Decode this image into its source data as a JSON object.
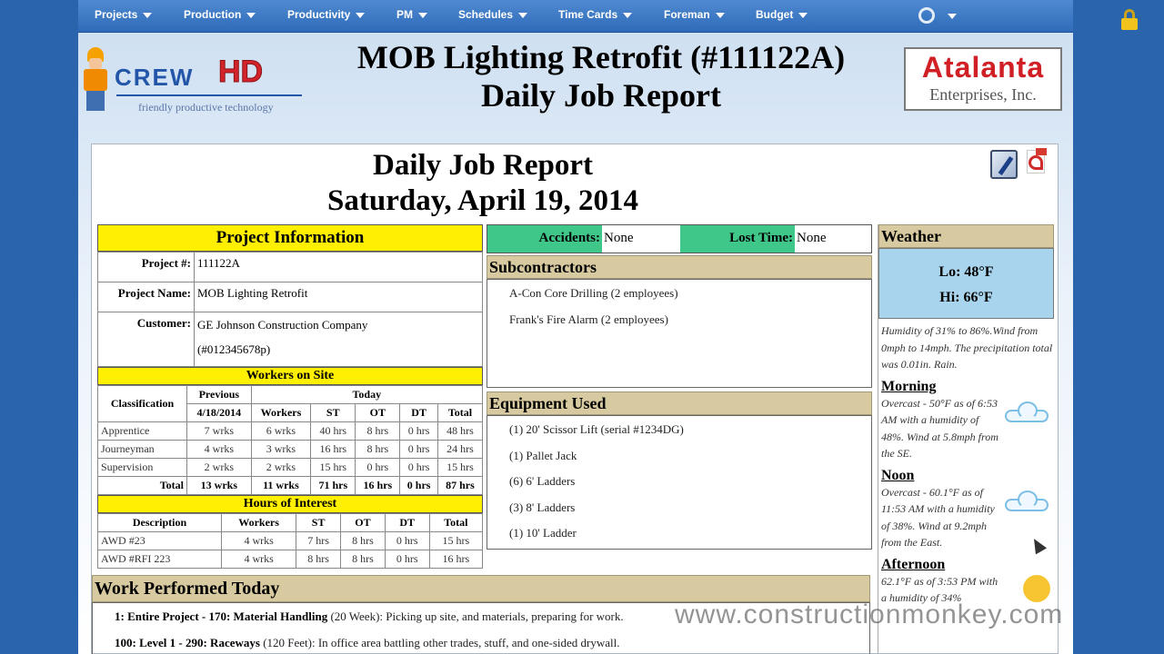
{
  "nav": {
    "items": [
      "Projects",
      "Production",
      "Productivity",
      "PM",
      "Schedules",
      "Time Cards",
      "Foreman",
      "Budget"
    ]
  },
  "branding": {
    "crew": "CREW",
    "hd": "HD",
    "tagline": "friendly productive technology",
    "company_line1": "Atalanta",
    "company_line2": "Enterprises, Inc."
  },
  "header": {
    "title_line1": "MOB Lighting Retrofit (#111122A)",
    "title_line2": "Daily Job Report"
  },
  "report": {
    "title": "Daily Job Report",
    "date": "Saturday, April 19, 2014"
  },
  "project_info": {
    "heading": "Project Information",
    "project_no_label": "Project #:",
    "project_no": "111122A",
    "project_name_label": "Project Name:",
    "project_name": "MOB Lighting Retrofit",
    "customer_label": "Customer:",
    "customer": "GE Johnson Construction Company",
    "customer_id": "(#012345678p)"
  },
  "workers_on_site": {
    "heading": "Workers on Site",
    "h_classification": "Classification",
    "h_previous": "Previous",
    "h_today": "Today",
    "h_prev_date": "4/18/2014",
    "h_workers": "Workers",
    "h_st": "ST",
    "h_ot": "OT",
    "h_dt": "DT",
    "h_total": "Total",
    "rows": [
      {
        "cls": "Apprentice",
        "prev": "7 wrks",
        "workers": "6 wrks",
        "st": "40 hrs",
        "ot": "8 hrs",
        "dt": "0 hrs",
        "total": "48 hrs"
      },
      {
        "cls": "Journeyman",
        "prev": "4 wrks",
        "workers": "3 wrks",
        "st": "16 hrs",
        "ot": "8 hrs",
        "dt": "0 hrs",
        "total": "24 hrs"
      },
      {
        "cls": "Supervision",
        "prev": "2 wrks",
        "workers": "2 wrks",
        "st": "15 hrs",
        "ot": "0 hrs",
        "dt": "0 hrs",
        "total": "15 hrs"
      }
    ],
    "total": {
      "label": "Total",
      "prev": "13 wrks",
      "workers": "11 wrks",
      "st": "71 hrs",
      "ot": "16 hrs",
      "dt": "0 hrs",
      "total": "87 hrs"
    }
  },
  "hours_of_interest": {
    "heading": "Hours of Interest",
    "h_description": "Description",
    "h_workers": "Workers",
    "h_st": "ST",
    "h_ot": "OT",
    "h_dt": "DT",
    "h_total": "Total",
    "rows": [
      {
        "desc": "AWD #23",
        "workers": "4 wrks",
        "st": "7 hrs",
        "ot": "8 hrs",
        "dt": "0 hrs",
        "total": "15 hrs"
      },
      {
        "desc": "AWD #RFI 223",
        "workers": "4 wrks",
        "st": "8 hrs",
        "ot": "8 hrs",
        "dt": "0 hrs",
        "total": "16 hrs"
      }
    ]
  },
  "incidents": {
    "accidents_label": "Accidents:",
    "accidents": "None",
    "lost_time_label": "Lost Time:",
    "lost_time": "None"
  },
  "subcontractors": {
    "heading": "Subcontractors",
    "items": [
      "A-Con Core Drilling (2 employees)",
      "Frank's Fire Alarm (2 employees)"
    ]
  },
  "equipment": {
    "heading": "Equipment Used",
    "items": [
      "(1) 20' Scissor Lift (serial #1234DG)",
      "(1) Pallet Jack",
      "(6) 6' Ladders",
      "(3) 8' Ladders",
      "(1) 10' Ladder"
    ]
  },
  "weather": {
    "heading": "Weather",
    "lo": "Lo: 48°F",
    "hi": "Hi: 66°F",
    "summary": "Humidity of 31% to 86%.Wind from 0mph to 14mph. The precipitation total was 0.01in. Rain.",
    "periods": [
      {
        "name": "Morning",
        "desc": "Overcast - 50°F as of 6:53 AM with a humidity of 48%. Wind at 5.8mph from the SE.",
        "icon": "cloud-icon"
      },
      {
        "name": "Noon",
        "desc": "Overcast - 60.1°F as of 11:53 AM with a humidity of 38%. Wind at 9.2mph from the East.",
        "icon": "cloud-icon"
      },
      {
        "name": "Afternoon",
        "desc": "62.1°F as of 3:53 PM with a humidity of 34%",
        "icon": "partly-sunny-icon"
      }
    ]
  },
  "work_performed": {
    "heading": "Work Performed Today",
    "lines": [
      {
        "bold": "1: Entire Project - 170: Material Handling",
        "text": " (20 Week): Picking up site, and materials, preparing for work."
      },
      {
        "bold": "100: Level 1 - 290: Raceways",
        "text": " (120 Feet): In office area battling other trades, stuff, and one-sided drywall."
      }
    ]
  },
  "watermark": "www.constructionmonkey.com",
  "colors": {
    "nav_bg": "#2f6bb8",
    "yellow_head": "#ffef00",
    "green_label": "#3fc78a",
    "tan_head": "#d7c9a0",
    "weather_blue": "#a9d4ee"
  }
}
